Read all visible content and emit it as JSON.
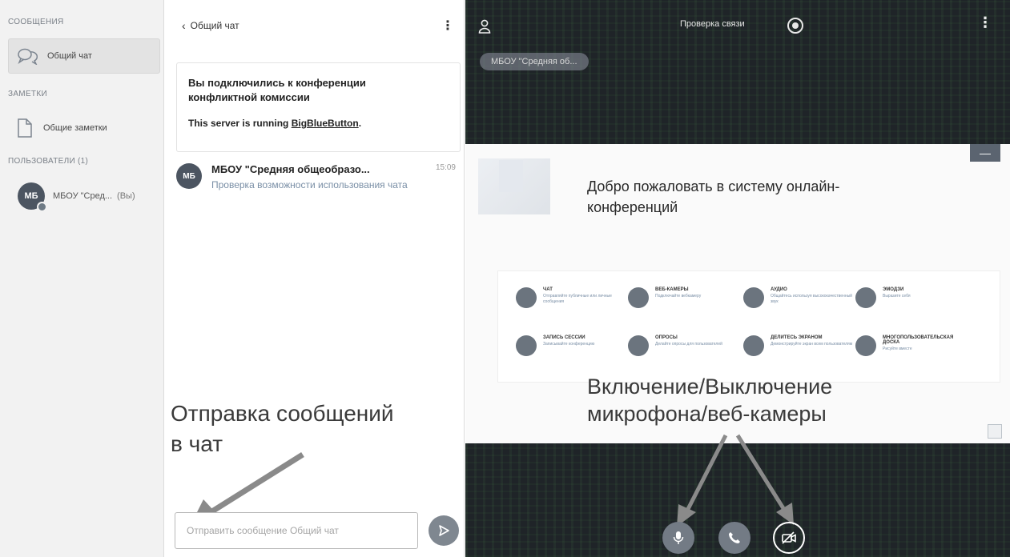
{
  "sidebar": {
    "messages_title": "СООБЩЕНИЯ",
    "public_chat_label": "Общий чат",
    "notes_title": "ЗАМЕТКИ",
    "shared_notes_label": "Общие заметки",
    "users_title": "ПОЛЬЗОВАТЕЛИ (1)",
    "user": {
      "initials": "МБ",
      "name": "МБОУ \"Сред...",
      "suffix": "(Вы)"
    }
  },
  "chat": {
    "back_label": "Общий чат",
    "welcome_line": "Вы подключились к конференции конфликтной комиссии",
    "server_prefix": "This server is running ",
    "server_link": "BigBlueButton",
    "server_suffix": ".",
    "message": {
      "initials": "МБ",
      "author": "МБОУ \"Средняя общеобразо...",
      "time": "15:09",
      "text": "Проверка возможности использования чата"
    },
    "input_placeholder": "Отправить сообщение Общий чат"
  },
  "annotations": {
    "send_line1": "Отправка сообщений",
    "send_line2": "в чат",
    "media_line1": "Включение/Выключение",
    "media_line2": "микрофона/веб-камеры"
  },
  "main": {
    "title": "Проверка связи",
    "presenter": "МБОУ \"Средняя об...",
    "slide": {
      "title": "Добро пожаловать в систему онлайн-конференций",
      "minimize_label": "—",
      "features": [
        {
          "title": "ЧАТ",
          "desc": "Отправляйте публичные или личные сообщения"
        },
        {
          "title": "ВЕБ-КАМЕРЫ",
          "desc": "Подключайте вебкамеру"
        },
        {
          "title": "АУДИО",
          "desc": "Общайтесь используя высококачественный звук"
        },
        {
          "title": "ЭМОДЗИ",
          "desc": "Выразите себя"
        },
        {
          "title": "ЗАПИСЬ СЕССИИ",
          "desc": "Записывайте конференцию"
        },
        {
          "title": "ОПРОСЫ",
          "desc": "Делайте опросы для пользователей"
        },
        {
          "title": "ДЕЛИТЕСЬ ЭКРАНОМ",
          "desc": "Демонстрируйте экран всем пользователям"
        },
        {
          "title": "МНОГОПОЛЬЗОВАТЕЛЬСКАЯ ДОСКА",
          "desc": "Рисуйте вместе"
        }
      ]
    }
  }
}
